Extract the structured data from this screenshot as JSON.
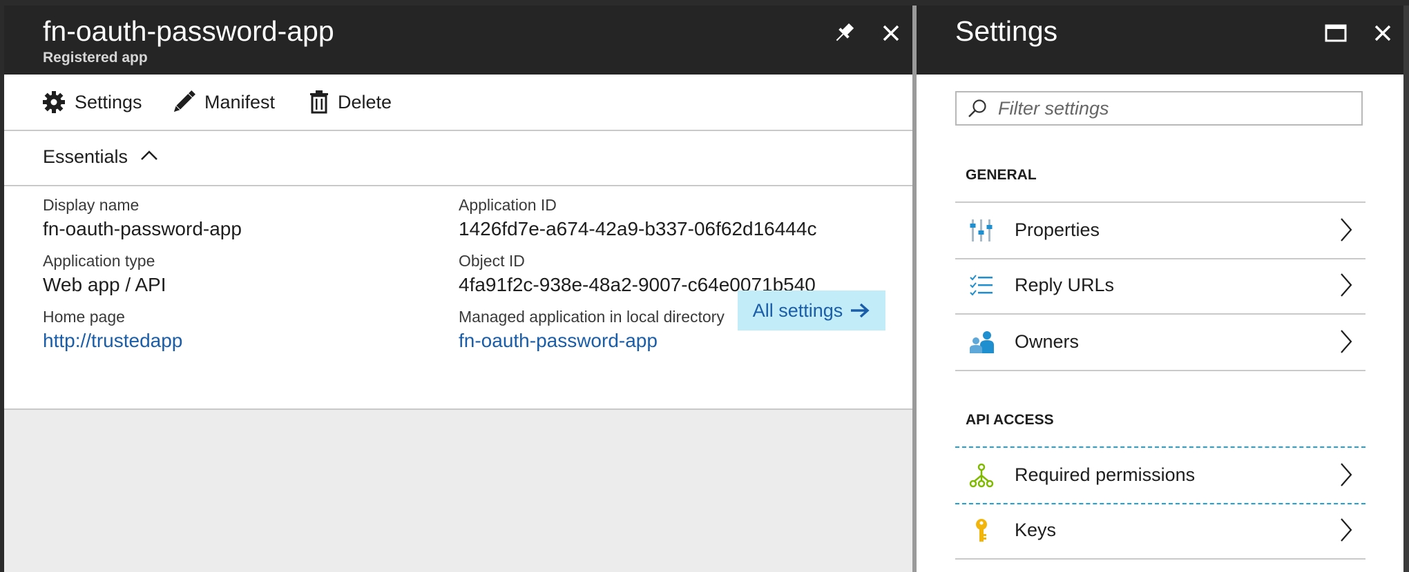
{
  "app_blade": {
    "title": "fn-oauth-password-app",
    "subtitle": "Registered app",
    "toolbar": {
      "settings_label": "Settings",
      "manifest_label": "Manifest",
      "delete_label": "Delete"
    },
    "essentials_label": "Essentials",
    "fields": {
      "display_name_label": "Display name",
      "display_name_value": "fn-oauth-password-app",
      "application_type_label": "Application type",
      "application_type_value": "Web app / API",
      "home_page_label": "Home page",
      "home_page_value": "http://trustedapp",
      "application_id_label": "Application ID",
      "application_id_value": "1426fd7e-a674-42a9-b337-06f62d16444c",
      "object_id_label": "Object ID",
      "object_id_value": "4fa91f2c-938e-48a2-9007-c64e0071b540",
      "managed_app_label": "Managed application in local directory",
      "managed_app_value": "fn-oauth-password-app"
    },
    "all_settings_label": "All settings"
  },
  "settings_blade": {
    "title": "Settings",
    "filter_placeholder": "Filter settings",
    "general_header": "GENERAL",
    "general_items": [
      {
        "label": "Properties",
        "icon": "properties-icon"
      },
      {
        "label": "Reply URLs",
        "icon": "reply-urls-icon"
      },
      {
        "label": "Owners",
        "icon": "owners-icon"
      }
    ],
    "api_access_header": "API ACCESS",
    "api_access_items": [
      {
        "label": "Required permissions",
        "icon": "required-permissions-icon"
      },
      {
        "label": "Keys",
        "icon": "keys-icon"
      }
    ]
  },
  "colors": {
    "header_bg": "#252526",
    "link": "#1a5da8",
    "all_settings_bg": "#c2ecf8",
    "selection_dash": "#1ea3d9",
    "permissions_green": "#7fba00",
    "keys_yellow": "#f2b50c",
    "azure_blue": "#1f8fd0"
  }
}
